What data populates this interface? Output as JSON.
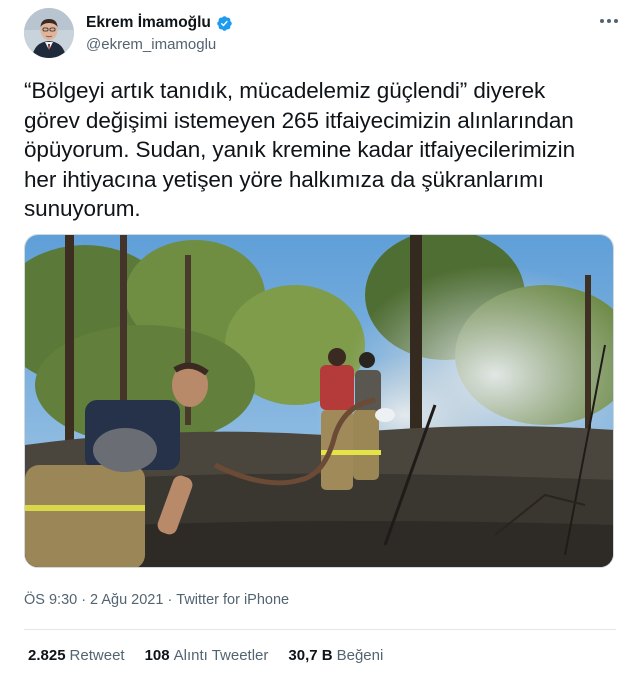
{
  "author": {
    "display_name": "Ekrem İmamoğlu",
    "handle": "@ekrem_imamoglu",
    "verified": true
  },
  "tweet": {
    "text_lines": [
      "“Bölgeyi artık tanıdık, mücadelemiz güçlendi” diyerek",
      "görev değişimi istemeyen 265 itfaiyecimizin alınlarından",
      "öpüyorum. Sudan, yanık kremine kadar itfaiyecilerimizin",
      "her ihtiyacına yetişen yöre halkımıza da şükranlarımı",
      "sunuyorum."
    ]
  },
  "meta": {
    "time": "ÖS 9:30",
    "separator1": "·",
    "date": "2 Ağu 2021",
    "separator2": "·",
    "source": "Twitter for iPhone"
  },
  "stats": {
    "retweets": {
      "count": "2.825",
      "label": "Retweet"
    },
    "quotes": {
      "count": "108",
      "label": "Alıntı Tweetler"
    },
    "likes": {
      "count": "30,7 B",
      "label": "Beğeni"
    }
  },
  "icons": {
    "verified": "verified-badge-icon",
    "more": "more-options-icon"
  },
  "colors": {
    "text": "#0f1419",
    "secondary": "#536471",
    "verified": "#1d9bf0",
    "divider": "#e1e8ed"
  }
}
